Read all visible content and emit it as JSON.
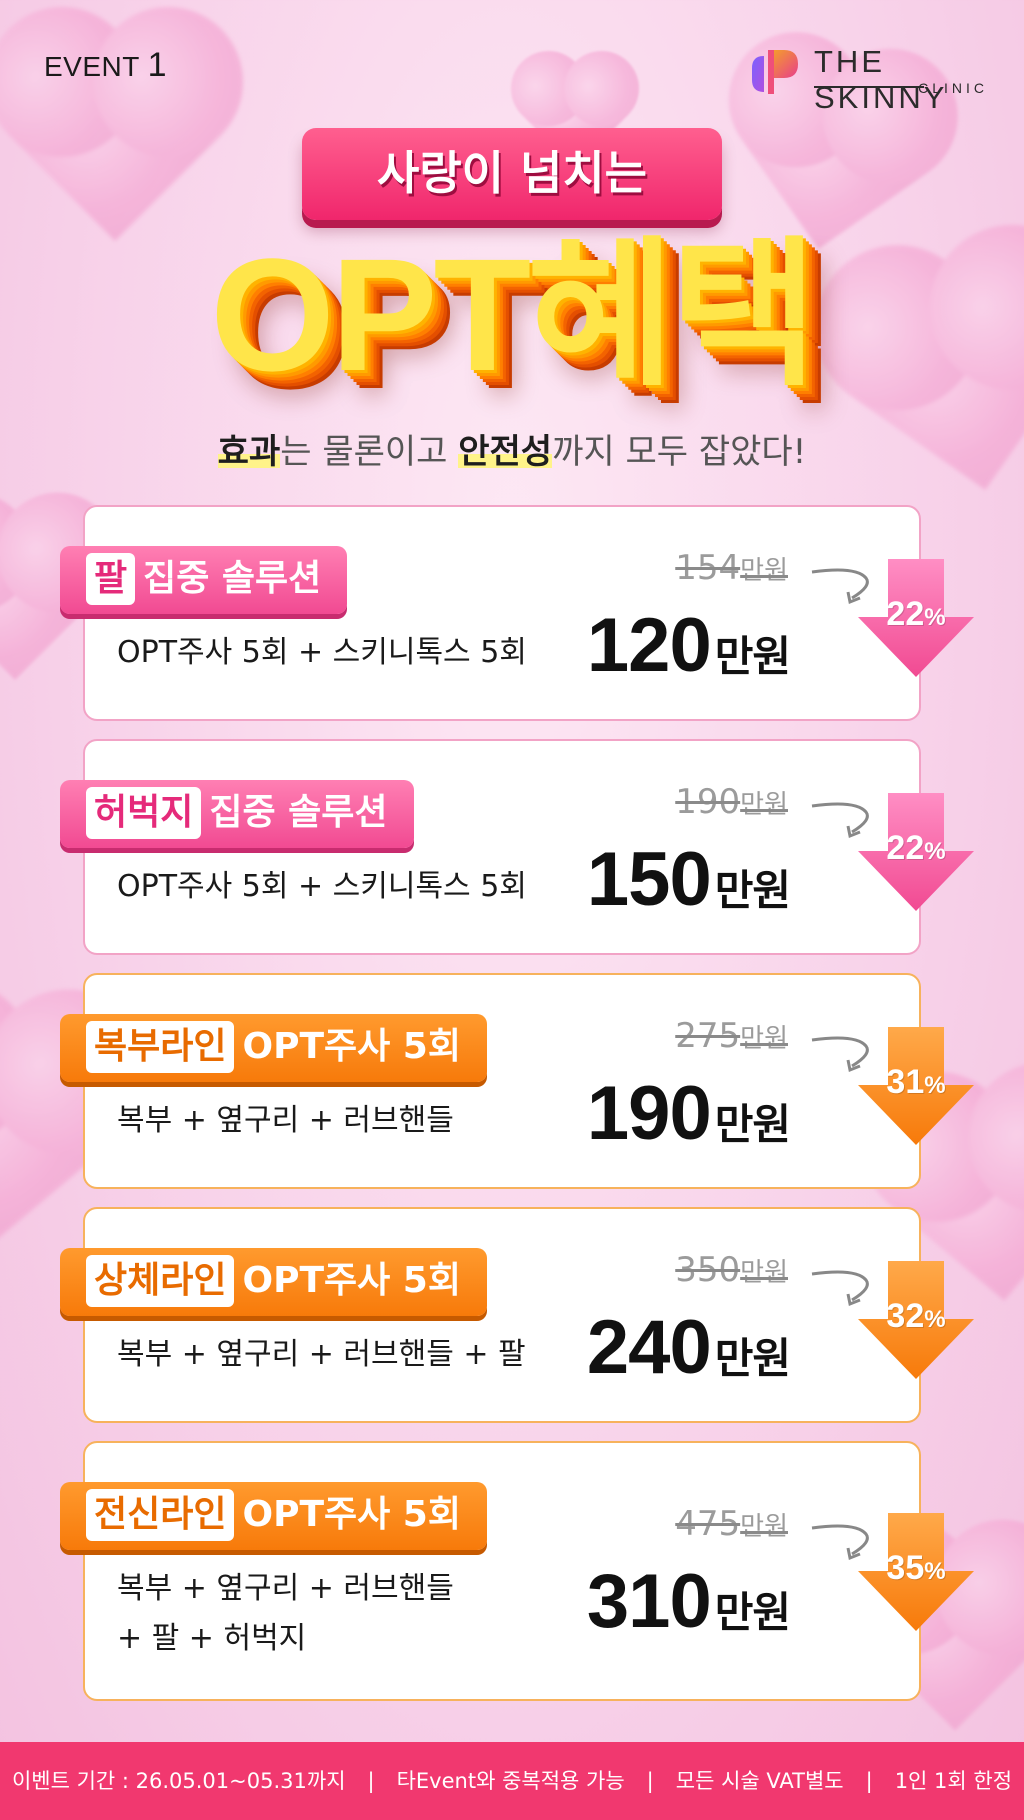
{
  "event": {
    "prefix": "EVENT",
    "number": "1"
  },
  "brand": {
    "name": "THE SKINNY",
    "sub": "CLINIC"
  },
  "header": {
    "banner": "사랑이 넘치는",
    "headline": "OPT혜택",
    "sub_parts": [
      "효과",
      "는 물론이고 ",
      "안전성",
      "까지 모두 잡았다!"
    ]
  },
  "colors": {
    "pink": "#f14a92",
    "orange": "#f77a0a",
    "footer": "#f1386f",
    "headline": "#ffe54a"
  },
  "unit": "만원",
  "cards": [
    {
      "label_em": "팔",
      "label_rest": "집중 솔루션",
      "theme": "pink",
      "desc": [
        "OPT주사 5회 + 스키니톡스 5회"
      ],
      "original": "154",
      "price": "120",
      "discount": "22"
    },
    {
      "label_em": "허벅지",
      "label_rest": "집중 솔루션",
      "theme": "pink",
      "desc": [
        "OPT주사 5회 + 스키니톡스 5회"
      ],
      "original": "190",
      "price": "150",
      "discount": "22"
    },
    {
      "label_em": "복부라인",
      "label_rest": "OPT주사 5회",
      "theme": "orange",
      "desc": [
        "복부 + 옆구리 + 러브핸들"
      ],
      "original": "275",
      "price": "190",
      "discount": "31"
    },
    {
      "label_em": "상체라인",
      "label_rest": "OPT주사 5회",
      "theme": "orange",
      "desc": [
        "복부 + 옆구리 + 러브핸들 + 팔"
      ],
      "original": "350",
      "price": "240",
      "discount": "32"
    },
    {
      "label_em": "전신라인",
      "label_rest": "OPT주사 5회",
      "theme": "orange",
      "desc": [
        "복부 + 옆구리 + 러브핸들",
        "+ 팔 + 허벅지"
      ],
      "original": "475",
      "price": "310",
      "discount": "35"
    }
  ],
  "footer": [
    "이벤트 기간 : 26.05.01~05.31까지",
    "타Event와 중복적용 가능",
    "모든 시술 VAT별도",
    "1인 1회 한정"
  ],
  "footer_sep": "|"
}
